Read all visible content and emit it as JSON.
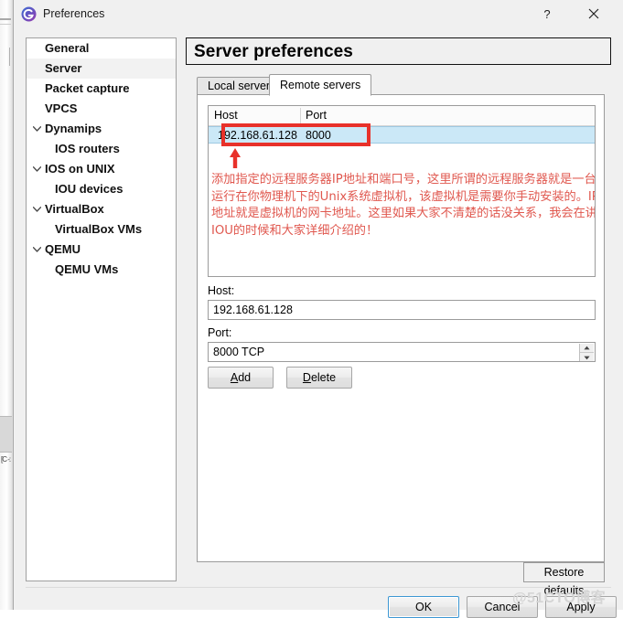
{
  "window": {
    "title": "Preferences",
    "icon": "gns3-logo-icon",
    "help_label": "?",
    "close_label": "✕"
  },
  "sidebar": {
    "items": [
      {
        "label": "General",
        "level": 0,
        "expander": "",
        "selected": false
      },
      {
        "label": "Server",
        "level": 0,
        "expander": "",
        "selected": true
      },
      {
        "label": "Packet capture",
        "level": 0,
        "expander": "",
        "selected": false
      },
      {
        "label": "VPCS",
        "level": 0,
        "expander": "",
        "selected": false
      },
      {
        "label": "Dynamips",
        "level": 0,
        "expander": "expanded",
        "selected": false
      },
      {
        "label": "IOS routers",
        "level": 1,
        "expander": "",
        "selected": false
      },
      {
        "label": "IOS on UNIX",
        "level": 0,
        "expander": "expanded",
        "selected": false
      },
      {
        "label": "IOU devices",
        "level": 1,
        "expander": "",
        "selected": false
      },
      {
        "label": "VirtualBox",
        "level": 0,
        "expander": "expanded",
        "selected": false
      },
      {
        "label": "VirtualBox VMs",
        "level": 1,
        "expander": "",
        "selected": false
      },
      {
        "label": "QEMU",
        "level": 0,
        "expander": "expanded",
        "selected": false
      },
      {
        "label": "QEMU VMs",
        "level": 1,
        "expander": "",
        "selected": false
      }
    ]
  },
  "main": {
    "page_title": "Server preferences",
    "tabs": [
      {
        "label": "Local server",
        "active": false
      },
      {
        "label": "Remote servers",
        "active": true
      }
    ],
    "server_list": {
      "columns": [
        "Host",
        "Port"
      ],
      "rows": [
        {
          "host": "192.168.61.128",
          "port": "8000",
          "selected": true
        }
      ]
    },
    "annotation": {
      "text": "添加指定的远程服务器IP地址和端口号，这里所谓的远程服务器就是一台运行在你物理机下的Unix系统虚拟机，该虚拟机是需要你手动安装的。IP地址就是虚拟机的网卡地址。这里如果大家不清楚的话没关系，我会在讲IOU的时候和大家详细介绍的！",
      "color": "#e0584f",
      "highlight_color": "#e8312a",
      "arrow": "up-arrow-icon"
    },
    "host_field": {
      "label": "Host:",
      "value": "192.168.61.128"
    },
    "port_field": {
      "label": "Port:",
      "value": "8000 TCP"
    },
    "add_button": {
      "accel": "A",
      "rest": "dd"
    },
    "delete_button": {
      "accel": "D",
      "rest": "elete"
    },
    "restore_defaults_label": "Restore defaults"
  },
  "footer": {
    "ok_label": "OK",
    "cancel_label": "Cancel",
    "apply_label": "Apply"
  },
  "watermark": {
    "text": "@51CTO博客"
  },
  "background_window": {
    "sliver_text": "[C\n-:"
  }
}
